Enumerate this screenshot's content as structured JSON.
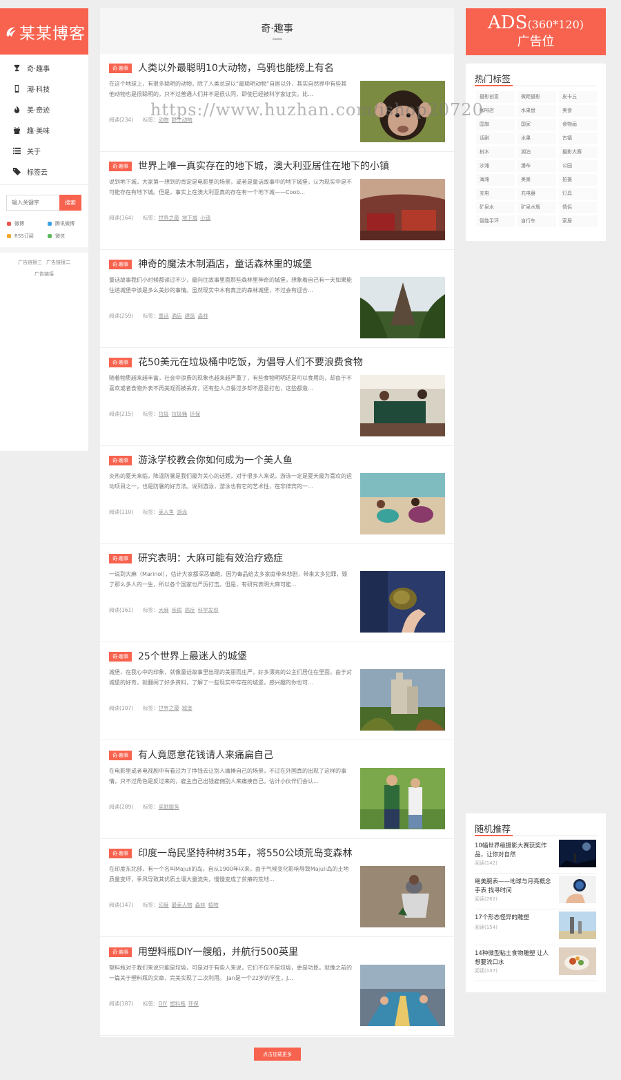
{
  "logo": {
    "text": "某某博客"
  },
  "nav": [
    {
      "label": "奇·趣事",
      "icon": "trophy-icon"
    },
    {
      "label": "潮·科技",
      "icon": "mobile-icon"
    },
    {
      "label": "美·奇迹",
      "icon": "fire-icon"
    },
    {
      "label": "趣·美味",
      "icon": "gift-icon"
    },
    {
      "label": "关于",
      "icon": "list-icon"
    },
    {
      "label": "标签云",
      "icon": "tag-icon"
    }
  ],
  "search": {
    "placeholder": "输入关键字",
    "button": "搜索"
  },
  "social": [
    {
      "label": "微博",
      "color": "#e9564e"
    },
    {
      "label": "腾讯微博",
      "color": "#3ea3e6"
    },
    {
      "label": "RSS订阅",
      "color": "#f4a52e"
    },
    {
      "label": "微信",
      "color": "#5cb85c"
    }
  ],
  "ad_links": [
    "广告链接三",
    "广告链接二",
    "广告链接"
  ],
  "section_title": "奇·趣事",
  "articles": [
    {
      "badge": "奇·趣事",
      "title": "人类以外最聪明10大动物，乌鸦也能榜上有名",
      "desc": "在这个地球上，有很多聪明的动物，除了人类总是以“最聪明动物”自居以外，其实自然界中有些其他动物也是很聪明的，只不过普通人们并不是很认同，即使已经被科学家证实。比...",
      "reads": "阅读(234)",
      "tags_label": "标签：",
      "tags": [
        "动物",
        "野生动物"
      ]
    },
    {
      "badge": "奇·趣事",
      "title": "世界上唯一真实存在的地下城，澳大利亚居住在地下的小镇",
      "desc": "说到地下城，大家第一想到的肯定是电影里的场景，或者是童话故事中的地下城堡，认为现实中是不可能存在有地下城。但是，事实上在澳大利亚真的存在有一个地下城——Coob...",
      "reads": "阅读(164)",
      "tags_label": "标签：",
      "tags": [
        "世界之最",
        "地下城",
        "小镇"
      ]
    },
    {
      "badge": "奇·趣事",
      "title": "神奇的魔法木制酒店，童话森林里的城堡",
      "desc": "童话故事我们小时候都读过不少，最向往故事里面那些森林里神奇的城堡，想象着自己有一天如果能住进城堡中该是多么美妙的事情。虽然现实中木有真正的森林城堡，不过会有迎合...",
      "reads": "阅读(259)",
      "tags_label": "标签：",
      "tags": [
        "童话",
        "酒店",
        "建筑",
        "森林"
      ]
    },
    {
      "badge": "奇·趣事",
      "title": "花50美元在垃圾桶中吃饭，为倡导人们不要浪费食物",
      "desc": "随着物质越来越丰富，社会中浪费的现象也越来越严重了，有些食物明明还是可以食用的，却由于不喜欢或者食物外表不再美观而被丢弃，还有些人点餐过多却不愿意打包，这些都造...",
      "reads": "阅读(215)",
      "tags_label": "标签：",
      "tags": [
        "垃圾",
        "垃圾桶",
        "环保"
      ]
    },
    {
      "badge": "奇·趣事",
      "title": "游泳学校教会你如何成为一个美人鱼",
      "desc": "炎热的夏天来临，降温防暑是我们最为关心的话题，对于很多人来说，游泳一定是夏天最为喜欢的运动项目之一，也是防暑的好方法。说到游泳，游泳也有它的艺术性，在非律宾的一...",
      "reads": "阅读(110)",
      "tags_label": "标签：",
      "tags": [
        "美人鱼",
        "游泳"
      ]
    },
    {
      "badge": "奇·趣事",
      "title": "研究表明：大麻可能有效治疗癌症",
      "desc": "一说到大麻（Marinol），估计大家都深恶痛绝，因为毒品给太多家庭带来悲剧，带来太多犯罪，毁了那么多人的一生，所以各个国家也严厉打击。但是，有研究表明大麻可能...",
      "reads": "阅读(161)",
      "tags_label": "标签：",
      "tags": [
        "大麻",
        "疾病",
        "癌症",
        "科学发现"
      ]
    },
    {
      "badge": "奇·趣事",
      "title": "25个世界上最迷人的城堡",
      "desc": "城堡，在我心中的印象，就像童话故事里出现的美丽而庄严，好多漂亮的公主们居住在里面。由于对城堡的好奇，就翻阅了好多资料，了解了一些现实中存在的城堡，感兴趣的你也可...",
      "reads": "阅读(107)",
      "tags_label": "标签：",
      "tags": [
        "世界之最",
        "城堡"
      ]
    },
    {
      "badge": "奇·趣事",
      "title": "有人竟愿意花钱请人来痛扁自己",
      "desc": "在电影里或者电视剧中有看过为了挣钱去让别人痛揍自己的场景，不过在外国真的出现了这样的事情，只不过角色是反过来的，雇主自己出钱雇佣别人来痛揍自己。估计小伙伴们会认...",
      "reads": "阅读(289)",
      "tags_label": "标签：",
      "tags": [
        "奖励服务"
      ]
    },
    {
      "badge": "奇·趣事",
      "title": "印度一岛民坚持种树35年，将550公顷荒岛变森林",
      "desc": "在印度东北部，有一个名叫Majuli的岛。自从1900年以来，由于气候变化影响导致Majuli岛的土地质量变坏，季风导致其优质土壤大量流失，慢慢变成了贫瘠的荒地...",
      "reads": "阅读(147)",
      "tags_label": "标签：",
      "tags": [
        "印度",
        "最美人物",
        "森林",
        "植物"
      ]
    },
    {
      "badge": "奇·趣事",
      "title": "用塑料瓶DIY一艘船，并航行500英里",
      "desc": "塑料瓶对于我们来说只能是垃圾，可是对于有些人来说，它们不仅不是垃圾，更是功臣。就像之前的一篇关于塑料瓶的文章，完美实现了二次利用。 Jan是一个22岁的学生，J...",
      "reads": "阅读(187)",
      "tags_label": "标签：",
      "tags": [
        "DIY",
        "塑料瓶",
        "环保"
      ]
    }
  ],
  "load_more": "点击加载更多",
  "ads": {
    "line1": "ADS",
    "size": "(360*120)",
    "line2": "广告位"
  },
  "hot_tags": {
    "title": "热门标签",
    "tags": [
      "摄影创意",
      "微距摄影",
      "皮卡丘",
      "咖啡店",
      "水果盘",
      "美食",
      "国旗",
      "国家",
      "食物画",
      "话剧",
      "水果",
      "古镇",
      "树木",
      "湖泊",
      "摄影大赛",
      "沙滩",
      "瀑布",
      "公园",
      "海滩",
      "美景",
      "拍摄",
      "充电",
      "充电器",
      "灯具",
      "矿泉水",
      "矿泉水瓶",
      "情侣",
      "智能手环",
      "自行车",
      "家居"
    ]
  },
  "random": {
    "title": "随机推荐",
    "items": [
      {
        "title": "10幅世界级摄影大赛获奖作品，让你对自然",
        "reads": "阅读(142)"
      },
      {
        "title": "绝美腕表——地球与月亮概念手表 找寻时间",
        "reads": "阅读(262)"
      },
      {
        "title": "17个形态怪异的雕塑",
        "reads": "阅读(154)"
      },
      {
        "title": "14种微型粘土食物雕塑 让人想要流口水",
        "reads": "阅读(137)"
      }
    ]
  },
  "watermark": "https://www.huzhan.com/ishop20720"
}
